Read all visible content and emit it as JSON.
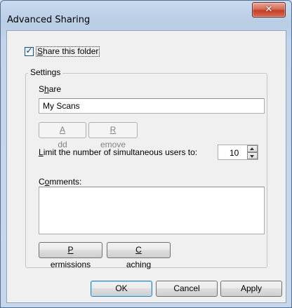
{
  "window": {
    "title": "Advanced Sharing",
    "close_glyph": "✕"
  },
  "share_folder": {
    "checked": true,
    "check_glyph": "✓",
    "label_pre": "",
    "label_mnemonic": "S",
    "label_post": "hare this folder"
  },
  "settings": {
    "group_label": "Settings",
    "share_label_pre": "S",
    "share_label_mnemonic": "h",
    "share_label_post": "are",
    "share_name": "My Scans",
    "add_label_pre": "",
    "add_label_mnemonic": "A",
    "add_label_post": "dd",
    "remove_label_pre": "",
    "remove_label_mnemonic": "R",
    "remove_label_post": "emove",
    "limit_label_pre": "",
    "limit_label_mnemonic": "L",
    "limit_label_post": "imit the number of simultaneous users to:",
    "limit_value": "10",
    "comments_label_pre": "C",
    "comments_label_mnemonic": "o",
    "comments_label_post": "mments:",
    "comments_value": "",
    "permissions_pre": "",
    "permissions_mnemonic": "P",
    "permissions_post": "ermissions",
    "caching_pre": "",
    "caching_mnemonic": "C",
    "caching_post": "aching"
  },
  "footer": {
    "ok_label": "OK",
    "cancel_label": "Cancel",
    "apply_label": "Apply"
  }
}
